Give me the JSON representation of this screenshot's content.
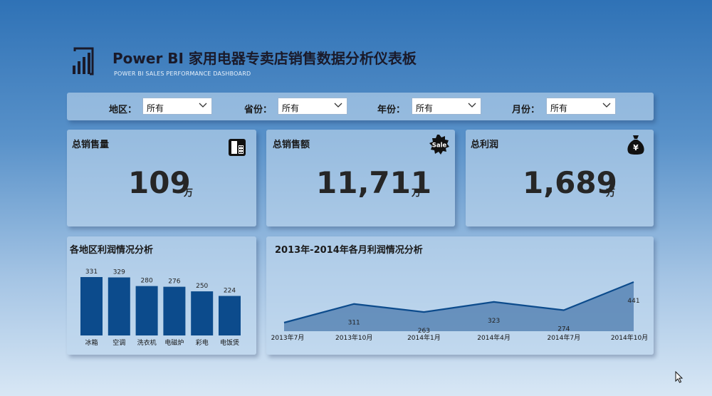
{
  "header": {
    "title": "Power BI 家用电器专卖店销售数据分析仪表板",
    "subtitle": "POWER BI SALES PERFORMANCE DASHBOARD",
    "logo_icon": "powerbi-logo-icon"
  },
  "filters": [
    {
      "label": "地区：",
      "value": "所有"
    },
    {
      "label": "省份：",
      "value": "所有"
    },
    {
      "label": "年份：",
      "value": "所有"
    },
    {
      "label": "月份：",
      "value": "所有"
    }
  ],
  "kpis": [
    {
      "title": "总销售量",
      "value": "109",
      "unit": "万",
      "icon": "calculator-icon"
    },
    {
      "title": "总销售额",
      "value": "11,711",
      "unit": "万",
      "icon": "sale-badge-icon",
      "icon_text": "Sale"
    },
    {
      "title": "总利润",
      "value": "1,689",
      "unit": "万",
      "icon": "money-bag-icon",
      "icon_text": "¥"
    }
  ],
  "chart_data": [
    {
      "type": "bar",
      "title": "各地区利润情况分析",
      "categories": [
        "冰箱",
        "空调",
        "洗衣机",
        "电磁炉",
        "彩电",
        "电饭煲"
      ],
      "values": [
        331,
        329,
        280,
        276,
        250,
        224
      ],
      "color": "#0c4b8c",
      "ylim": [
        0,
        331
      ]
    },
    {
      "type": "area",
      "title": "2013年-2014年各月利润情况分析",
      "x": [
        "2013年7月",
        "2013年10月",
        "2014年1月",
        "2014年4月",
        "2014年7月",
        "2014年10月"
      ],
      "values": [
        200,
        311,
        263,
        323,
        274,
        441
      ],
      "labels": [
        null,
        "311",
        "263",
        "323",
        "274",
        "441"
      ],
      "line_color": "#0c4b8c",
      "fill_color": "#4f7eb0",
      "grid": false
    }
  ]
}
